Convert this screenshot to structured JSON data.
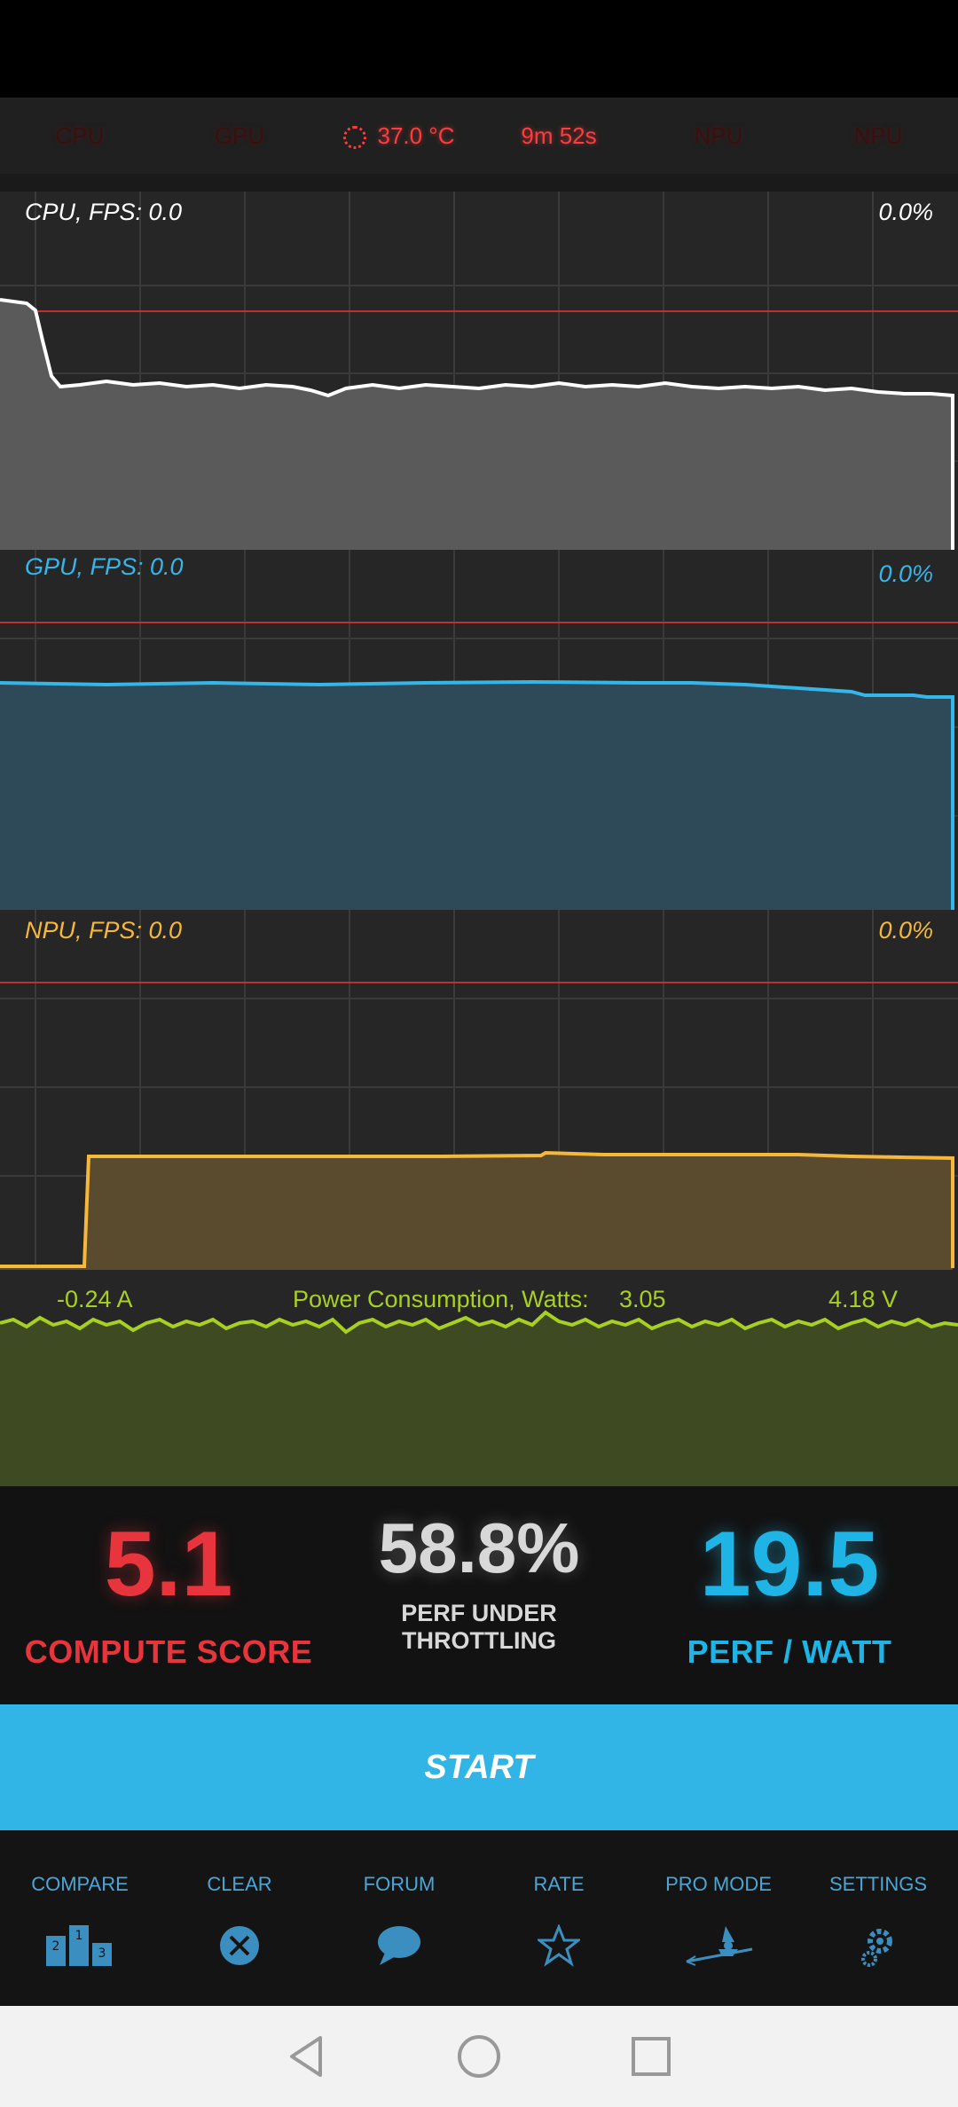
{
  "top_tabs": [
    {
      "label": "CPU"
    },
    {
      "label": "GPU"
    },
    {
      "label": "37.0 °C"
    },
    {
      "label": "9m 52s"
    },
    {
      "label": "NPU"
    },
    {
      "label": "NPU"
    }
  ],
  "graphs": {
    "cpu": {
      "label": "CPU, FPS:  0.0",
      "percent": "0.0%",
      "color": "#ffffff"
    },
    "gpu": {
      "label": "GPU, FPS:  0.0",
      "percent": "0.0%",
      "color": "#35b6e8"
    },
    "npu": {
      "label": "NPU, FPS:  0.0",
      "percent": "0.0%",
      "color": "#f5b83a"
    }
  },
  "power": {
    "current": "-0.24 A",
    "title": "Power Consumption, Watts:",
    "watts": "3.05",
    "voltage": "4.18 V",
    "color": "#a8d020"
  },
  "scores": {
    "compute": {
      "value": "5.1",
      "label": "COMPUTE SCORE",
      "color": "#e8343c"
    },
    "throttling": {
      "value": "58.8%",
      "label_line1": "PERF UNDER",
      "label_line2": "THROTTLING"
    },
    "perf_watt": {
      "value": "19.5",
      "label": "PERF / WATT",
      "color": "#1eb4e6"
    }
  },
  "start_button": {
    "label": "START"
  },
  "bottom_nav": [
    {
      "label": "COMPARE",
      "icon": "podium-icon"
    },
    {
      "label": "CLEAR",
      "icon": "clear-x-icon"
    },
    {
      "label": "FORUM",
      "icon": "chat-bubble-icon"
    },
    {
      "label": "RATE",
      "icon": "star-icon"
    },
    {
      "label": "PRO MODE",
      "icon": "witch-icon"
    },
    {
      "label": "SETTINGS",
      "icon": "gear-icon"
    }
  ],
  "system_nav": [
    {
      "icon": "back-icon"
    },
    {
      "icon": "home-icon"
    },
    {
      "icon": "recents-icon"
    }
  ]
}
